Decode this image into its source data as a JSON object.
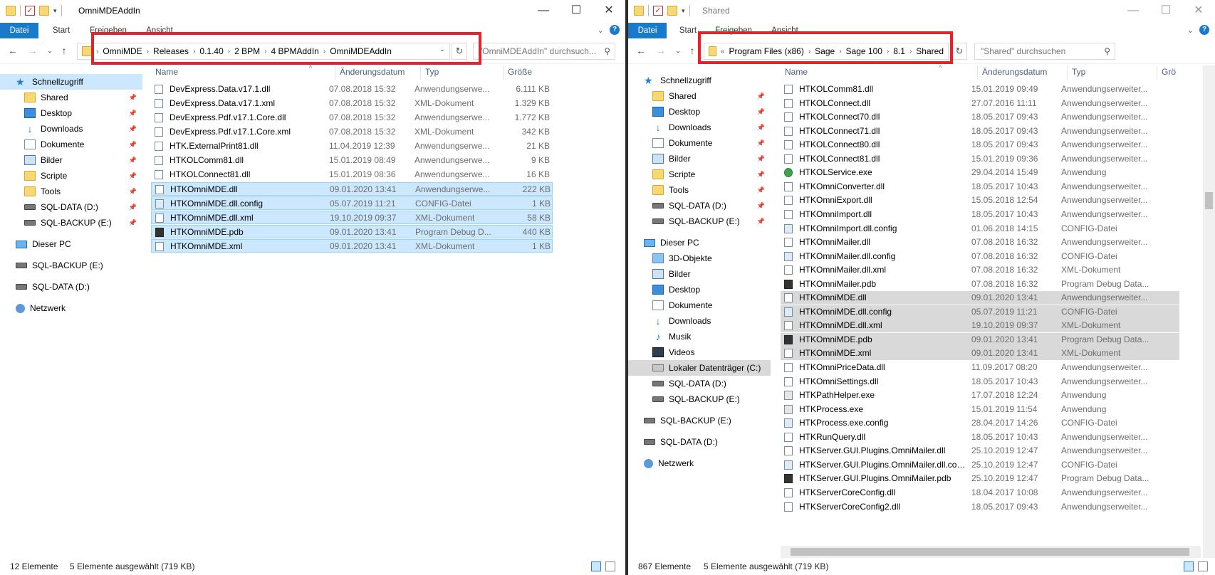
{
  "left": {
    "title": "OmniMDEAddIn",
    "ribbon_tabs": [
      "Datei",
      "Start",
      "Freigeben",
      "Ansicht"
    ],
    "breadcrumb": [
      "OmniMDE",
      "Releases",
      "0.1.40",
      "2 BPM",
      "4 BPMAddIn",
      "OmniMDEAddIn"
    ],
    "search_placeholder": "\"OmniMDEAddIn\" durchsuch...",
    "columns": [
      "Name",
      "Änderungsdatum",
      "Typ",
      "Größe"
    ],
    "nav": [
      {
        "label": "Schnellzugriff",
        "icon": "star",
        "sel": true,
        "pin": false
      },
      {
        "label": "Shared",
        "icon": "folder",
        "pin": true
      },
      {
        "label": "Desktop",
        "icon": "desk",
        "pin": true
      },
      {
        "label": "Downloads",
        "icon": "dl",
        "pin": true
      },
      {
        "label": "Dokumente",
        "icon": "doc",
        "pin": true
      },
      {
        "label": "Bilder",
        "icon": "pic",
        "pin": true
      },
      {
        "label": "Scripte",
        "icon": "folder",
        "pin": true
      },
      {
        "label": "Tools",
        "icon": "folder",
        "pin": true
      },
      {
        "label": "SQL-DATA (D:)",
        "icon": "drv",
        "pin": true
      },
      {
        "label": "SQL-BACKUP (E:)",
        "icon": "drv",
        "pin": true
      },
      {
        "label": "Dieser PC",
        "icon": "pc",
        "top": true
      },
      {
        "label": "SQL-BACKUP (E:)",
        "icon": "drv",
        "top": true
      },
      {
        "label": "SQL-DATA (D:)",
        "icon": "drv",
        "top": true
      },
      {
        "label": "Netzwerk",
        "icon": "net",
        "top": true
      }
    ],
    "files": [
      {
        "name": "DevExpress.Data.v17.1.dll",
        "date": "07.08.2018 15:32",
        "type": "Anwendungserwe...",
        "size": "6.111 KB",
        "icon": "dll"
      },
      {
        "name": "DevExpress.Data.v17.1.xml",
        "date": "07.08.2018 15:32",
        "type": "XML-Dokument",
        "size": "1.329 KB",
        "icon": "xml"
      },
      {
        "name": "DevExpress.Pdf.v17.1.Core.dll",
        "date": "07.08.2018 15:32",
        "type": "Anwendungserwe...",
        "size": "1.772 KB",
        "icon": "dll"
      },
      {
        "name": "DevExpress.Pdf.v17.1.Core.xml",
        "date": "07.08.2018 15:32",
        "type": "XML-Dokument",
        "size": "342 KB",
        "icon": "xml"
      },
      {
        "name": "HTK.ExternalPrint81.dll",
        "date": "11.04.2019 12:39",
        "type": "Anwendungserwe...",
        "size": "21 KB",
        "icon": "dll"
      },
      {
        "name": "HTKOLComm81.dll",
        "date": "15.01.2019 08:49",
        "type": "Anwendungserwe...",
        "size": "9 KB",
        "icon": "dll"
      },
      {
        "name": "HTKOLConnect81.dll",
        "date": "15.01.2019 08:36",
        "type": "Anwendungserwe...",
        "size": "16 KB",
        "icon": "dll"
      },
      {
        "name": "HTKOmniMDE.dll",
        "date": "09.01.2020 13:41",
        "type": "Anwendungserwe...",
        "size": "222 KB",
        "icon": "dll",
        "sel": true
      },
      {
        "name": "HTKOmniMDE.dll.config",
        "date": "05.07.2019 11:21",
        "type": "CONFIG-Datei",
        "size": "1 KB",
        "icon": "cfg",
        "sel": true
      },
      {
        "name": "HTKOmniMDE.dll.xml",
        "date": "19.10.2019 09:37",
        "type": "XML-Dokument",
        "size": "58 KB",
        "icon": "xml",
        "sel": true
      },
      {
        "name": "HTKOmniMDE.pdb",
        "date": "09.01.2020 13:41",
        "type": "Program Debug D...",
        "size": "440 KB",
        "icon": "pdb",
        "sel": true
      },
      {
        "name": "HTKOmniMDE.xml",
        "date": "09.01.2020 13:41",
        "type": "XML-Dokument",
        "size": "1 KB",
        "icon": "xml",
        "sel": true
      }
    ],
    "status_count": "12 Elemente",
    "status_sel": "5 Elemente ausgewählt (719 KB)"
  },
  "right": {
    "title": "Shared",
    "ribbon_tabs": [
      "Datei",
      "Start",
      "Freigeben",
      "Ansicht"
    ],
    "breadcrumb_prefix": "«",
    "breadcrumb": [
      "Program Files (x86)",
      "Sage",
      "Sage 100",
      "8.1",
      "Shared"
    ],
    "search_placeholder": "\"Shared\" durchsuchen",
    "columns": [
      "Name",
      "Änderungsdatum",
      "Typ",
      "Grö"
    ],
    "nav": [
      {
        "label": "Schnellzugriff",
        "icon": "star",
        "pin": false
      },
      {
        "label": "Shared",
        "icon": "folder",
        "pin": true
      },
      {
        "label": "Desktop",
        "icon": "desk",
        "pin": true
      },
      {
        "label": "Downloads",
        "icon": "dl",
        "pin": true
      },
      {
        "label": "Dokumente",
        "icon": "doc",
        "pin": true
      },
      {
        "label": "Bilder",
        "icon": "pic",
        "pin": true
      },
      {
        "label": "Scripte",
        "icon": "folder",
        "pin": true
      },
      {
        "label": "Tools",
        "icon": "folder",
        "pin": true
      },
      {
        "label": "SQL-DATA (D:)",
        "icon": "drv",
        "pin": true
      },
      {
        "label": "SQL-BACKUP (E:)",
        "icon": "drv",
        "pin": true
      },
      {
        "label": "Dieser PC",
        "icon": "pc",
        "top": true
      },
      {
        "label": "3D-Objekte",
        "icon": "cube"
      },
      {
        "label": "Bilder",
        "icon": "pic"
      },
      {
        "label": "Desktop",
        "icon": "desk"
      },
      {
        "label": "Dokumente",
        "icon": "doc"
      },
      {
        "label": "Downloads",
        "icon": "dl"
      },
      {
        "label": "Musik",
        "icon": "mus"
      },
      {
        "label": "Videos",
        "icon": "vid"
      },
      {
        "label": "Lokaler Datenträger (C:)",
        "icon": "hdd",
        "gsel": true
      },
      {
        "label": "SQL-DATA (D:)",
        "icon": "drv"
      },
      {
        "label": "SQL-BACKUP (E:)",
        "icon": "drv"
      },
      {
        "label": "SQL-BACKUP (E:)",
        "icon": "drv",
        "top": true
      },
      {
        "label": "SQL-DATA (D:)",
        "icon": "drv",
        "top": true
      },
      {
        "label": "Netzwerk",
        "icon": "net",
        "top": true
      }
    ],
    "files": [
      {
        "name": "HTKOLComm81.dll",
        "date": "15.01.2019 09:49",
        "type": "Anwendungserweiter...",
        "icon": "dll"
      },
      {
        "name": "HTKOLConnect.dll",
        "date": "27.07.2016 11:11",
        "type": "Anwendungserweiter...",
        "icon": "dll"
      },
      {
        "name": "HTKOLConnect70.dll",
        "date": "18.05.2017 09:43",
        "type": "Anwendungserweiter...",
        "icon": "dll"
      },
      {
        "name": "HTKOLConnect71.dll",
        "date": "18.05.2017 09:43",
        "type": "Anwendungserweiter...",
        "icon": "dll"
      },
      {
        "name": "HTKOLConnect80.dll",
        "date": "18.05.2017 09:43",
        "type": "Anwendungserweiter...",
        "icon": "dll"
      },
      {
        "name": "HTKOLConnect81.dll",
        "date": "15.01.2019 09:36",
        "type": "Anwendungserweiter...",
        "icon": "dll"
      },
      {
        "name": "HTKOLService.exe",
        "date": "29.04.2014 15:49",
        "type": "Anwendung",
        "icon": "gexe"
      },
      {
        "name": "HTKOmniConverter.dll",
        "date": "18.05.2017 10:43",
        "type": "Anwendungserweiter...",
        "icon": "dll"
      },
      {
        "name": "HTKOmniExport.dll",
        "date": "15.05.2018 12:54",
        "type": "Anwendungserweiter...",
        "icon": "dll"
      },
      {
        "name": "HTKOmniImport.dll",
        "date": "18.05.2017 10:43",
        "type": "Anwendungserweiter...",
        "icon": "dll"
      },
      {
        "name": "HTKOmniImport.dll.config",
        "date": "01.06.2018 14:15",
        "type": "CONFIG-Datei",
        "icon": "cfg"
      },
      {
        "name": "HTKOmniMailer.dll",
        "date": "07.08.2018 16:32",
        "type": "Anwendungserweiter...",
        "icon": "dll"
      },
      {
        "name": "HTKOmniMailer.dll.config",
        "date": "07.08.2018 16:32",
        "type": "CONFIG-Datei",
        "icon": "cfg"
      },
      {
        "name": "HTKOmniMailer.dll.xml",
        "date": "07.08.2018 16:32",
        "type": "XML-Dokument",
        "icon": "xml"
      },
      {
        "name": "HTKOmniMailer.pdb",
        "date": "07.08.2018 16:32",
        "type": "Program Debug Data...",
        "icon": "pdb"
      },
      {
        "name": "HTKOmniMDE.dll",
        "date": "09.01.2020 13:41",
        "type": "Anwendungserweiter...",
        "icon": "dll",
        "sel": true
      },
      {
        "name": "HTKOmniMDE.dll.config",
        "date": "05.07.2019 11:21",
        "type": "CONFIG-Datei",
        "icon": "cfg",
        "sel": true
      },
      {
        "name": "HTKOmniMDE.dll.xml",
        "date": "19.10.2019 09:37",
        "type": "XML-Dokument",
        "icon": "xml",
        "sel": true
      },
      {
        "name": "HTKOmniMDE.pdb",
        "date": "09.01.2020 13:41",
        "type": "Program Debug Data...",
        "icon": "pdb",
        "sel": true
      },
      {
        "name": "HTKOmniMDE.xml",
        "date": "09.01.2020 13:41",
        "type": "XML-Dokument",
        "icon": "xml",
        "sel": true
      },
      {
        "name": "HTKOmniPriceData.dll",
        "date": "11.09.2017 08:20",
        "type": "Anwendungserweiter...",
        "icon": "dll"
      },
      {
        "name": "HTKOmniSettings.dll",
        "date": "18.05.2017 10:43",
        "type": "Anwendungserweiter...",
        "icon": "dll"
      },
      {
        "name": "HTKPathHelper.exe",
        "date": "17.07.2018 12:24",
        "type": "Anwendung",
        "icon": "exe"
      },
      {
        "name": "HTKProcess.exe",
        "date": "15.01.2019 11:54",
        "type": "Anwendung",
        "icon": "exe"
      },
      {
        "name": "HTKProcess.exe.config",
        "date": "28.04.2017 14:26",
        "type": "CONFIG-Datei",
        "icon": "cfg"
      },
      {
        "name": "HTKRunQuery.dll",
        "date": "18.05.2017 10:43",
        "type": "Anwendungserweiter...",
        "icon": "dll"
      },
      {
        "name": "HTKServer.GUI.Plugins.OmniMailer.dll",
        "date": "25.10.2019 12:47",
        "type": "Anwendungserweiter...",
        "icon": "dll"
      },
      {
        "name": "HTKServer.GUI.Plugins.OmniMailer.dll.config",
        "date": "25.10.2019 12:47",
        "type": "CONFIG-Datei",
        "icon": "cfg"
      },
      {
        "name": "HTKServer.GUI.Plugins.OmniMailer.pdb",
        "date": "25.10.2019 12:47",
        "type": "Program Debug Data...",
        "icon": "pdb"
      },
      {
        "name": "HTKServerCoreConfig.dll",
        "date": "18.04.2017 10:08",
        "type": "Anwendungserweiter...",
        "icon": "dll"
      },
      {
        "name": "HTKServerCoreConfig2.dll",
        "date": "18.05.2017 09:43",
        "type": "Anwendungserweiter...",
        "icon": "dll"
      }
    ],
    "status_count": "867 Elemente",
    "status_sel": "5 Elemente ausgewählt (719 KB)"
  },
  "colors": {
    "accent": "#1979ca",
    "highlight": "#e3232c",
    "selection": "#cce8ff",
    "gray_selection": "#d9d9d9"
  }
}
